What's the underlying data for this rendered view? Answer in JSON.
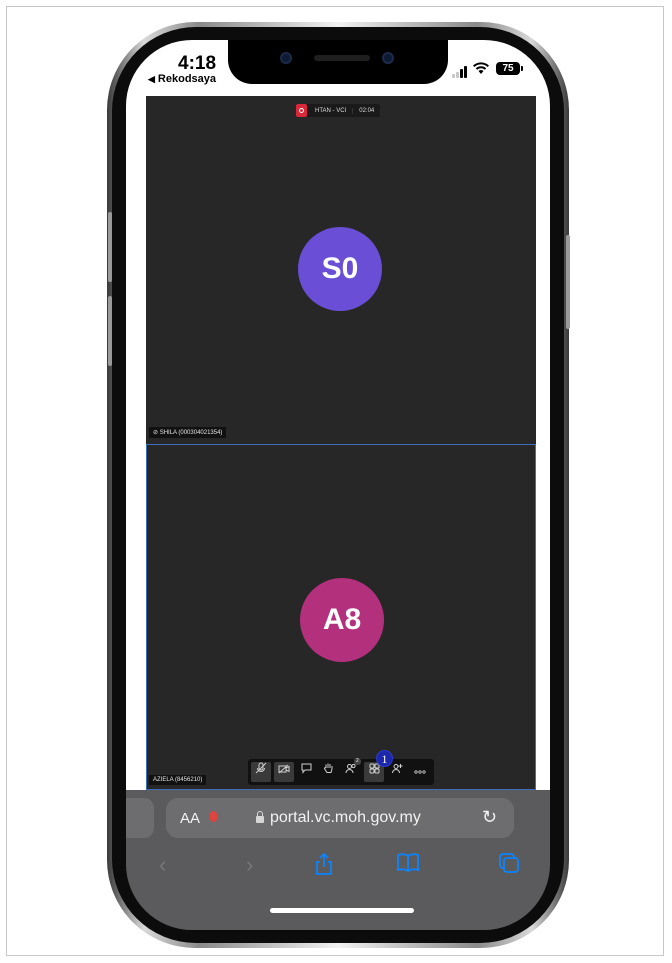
{
  "status_bar": {
    "time": "4:18",
    "back_app": "Rekodsaya",
    "battery": "75"
  },
  "meeting": {
    "room_title": "HTAN - VCI",
    "elapsed": "02:04",
    "participants": [
      {
        "initials": "S0",
        "name_tag": "SHILA (000304021354)",
        "color": "#6a4fd6"
      },
      {
        "initials": "A8",
        "name_tag": "AZIELA (8456210)",
        "color": "#b3307d"
      }
    ],
    "toolbar": {
      "participants_count": "2",
      "grid_badge": "1"
    }
  },
  "browser": {
    "text_size_label": "AA",
    "url": "portal.vc.moh.gov.my"
  },
  "colors": {
    "accent_blue": "#0a84ff",
    "record_red": "#d8283a",
    "active_tile_border": "#3d6fb8"
  }
}
